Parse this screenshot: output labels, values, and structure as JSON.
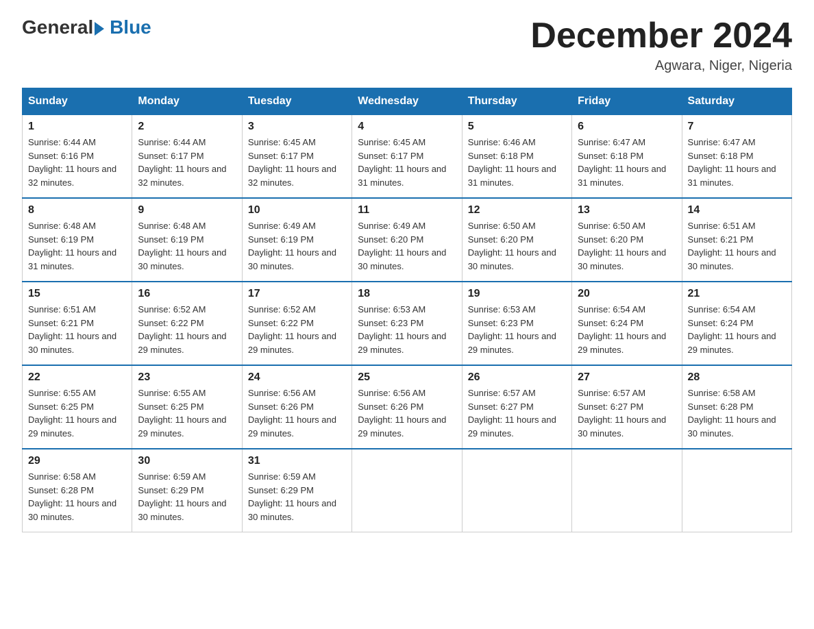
{
  "header": {
    "logo_general": "General",
    "logo_blue": "Blue",
    "month_title": "December 2024",
    "location": "Agwara, Niger, Nigeria"
  },
  "days_of_week": [
    "Sunday",
    "Monday",
    "Tuesday",
    "Wednesday",
    "Thursday",
    "Friday",
    "Saturday"
  ],
  "weeks": [
    [
      {
        "day": "1",
        "sunrise": "6:44 AM",
        "sunset": "6:16 PM",
        "daylight": "11 hours and 32 minutes."
      },
      {
        "day": "2",
        "sunrise": "6:44 AM",
        "sunset": "6:17 PM",
        "daylight": "11 hours and 32 minutes."
      },
      {
        "day": "3",
        "sunrise": "6:45 AM",
        "sunset": "6:17 PM",
        "daylight": "11 hours and 32 minutes."
      },
      {
        "day": "4",
        "sunrise": "6:45 AM",
        "sunset": "6:17 PM",
        "daylight": "11 hours and 31 minutes."
      },
      {
        "day": "5",
        "sunrise": "6:46 AM",
        "sunset": "6:18 PM",
        "daylight": "11 hours and 31 minutes."
      },
      {
        "day": "6",
        "sunrise": "6:47 AM",
        "sunset": "6:18 PM",
        "daylight": "11 hours and 31 minutes."
      },
      {
        "day": "7",
        "sunrise": "6:47 AM",
        "sunset": "6:18 PM",
        "daylight": "11 hours and 31 minutes."
      }
    ],
    [
      {
        "day": "8",
        "sunrise": "6:48 AM",
        "sunset": "6:19 PM",
        "daylight": "11 hours and 31 minutes."
      },
      {
        "day": "9",
        "sunrise": "6:48 AM",
        "sunset": "6:19 PM",
        "daylight": "11 hours and 30 minutes."
      },
      {
        "day": "10",
        "sunrise": "6:49 AM",
        "sunset": "6:19 PM",
        "daylight": "11 hours and 30 minutes."
      },
      {
        "day": "11",
        "sunrise": "6:49 AM",
        "sunset": "6:20 PM",
        "daylight": "11 hours and 30 minutes."
      },
      {
        "day": "12",
        "sunrise": "6:50 AM",
        "sunset": "6:20 PM",
        "daylight": "11 hours and 30 minutes."
      },
      {
        "day": "13",
        "sunrise": "6:50 AM",
        "sunset": "6:20 PM",
        "daylight": "11 hours and 30 minutes."
      },
      {
        "day": "14",
        "sunrise": "6:51 AM",
        "sunset": "6:21 PM",
        "daylight": "11 hours and 30 minutes."
      }
    ],
    [
      {
        "day": "15",
        "sunrise": "6:51 AM",
        "sunset": "6:21 PM",
        "daylight": "11 hours and 30 minutes."
      },
      {
        "day": "16",
        "sunrise": "6:52 AM",
        "sunset": "6:22 PM",
        "daylight": "11 hours and 29 minutes."
      },
      {
        "day": "17",
        "sunrise": "6:52 AM",
        "sunset": "6:22 PM",
        "daylight": "11 hours and 29 minutes."
      },
      {
        "day": "18",
        "sunrise": "6:53 AM",
        "sunset": "6:23 PM",
        "daylight": "11 hours and 29 minutes."
      },
      {
        "day": "19",
        "sunrise": "6:53 AM",
        "sunset": "6:23 PM",
        "daylight": "11 hours and 29 minutes."
      },
      {
        "day": "20",
        "sunrise": "6:54 AM",
        "sunset": "6:24 PM",
        "daylight": "11 hours and 29 minutes."
      },
      {
        "day": "21",
        "sunrise": "6:54 AM",
        "sunset": "6:24 PM",
        "daylight": "11 hours and 29 minutes."
      }
    ],
    [
      {
        "day": "22",
        "sunrise": "6:55 AM",
        "sunset": "6:25 PM",
        "daylight": "11 hours and 29 minutes."
      },
      {
        "day": "23",
        "sunrise": "6:55 AM",
        "sunset": "6:25 PM",
        "daylight": "11 hours and 29 minutes."
      },
      {
        "day": "24",
        "sunrise": "6:56 AM",
        "sunset": "6:26 PM",
        "daylight": "11 hours and 29 minutes."
      },
      {
        "day": "25",
        "sunrise": "6:56 AM",
        "sunset": "6:26 PM",
        "daylight": "11 hours and 29 minutes."
      },
      {
        "day": "26",
        "sunrise": "6:57 AM",
        "sunset": "6:27 PM",
        "daylight": "11 hours and 29 minutes."
      },
      {
        "day": "27",
        "sunrise": "6:57 AM",
        "sunset": "6:27 PM",
        "daylight": "11 hours and 30 minutes."
      },
      {
        "day": "28",
        "sunrise": "6:58 AM",
        "sunset": "6:28 PM",
        "daylight": "11 hours and 30 minutes."
      }
    ],
    [
      {
        "day": "29",
        "sunrise": "6:58 AM",
        "sunset": "6:28 PM",
        "daylight": "11 hours and 30 minutes."
      },
      {
        "day": "30",
        "sunrise": "6:59 AM",
        "sunset": "6:29 PM",
        "daylight": "11 hours and 30 minutes."
      },
      {
        "day": "31",
        "sunrise": "6:59 AM",
        "sunset": "6:29 PM",
        "daylight": "11 hours and 30 minutes."
      },
      null,
      null,
      null,
      null
    ]
  ]
}
